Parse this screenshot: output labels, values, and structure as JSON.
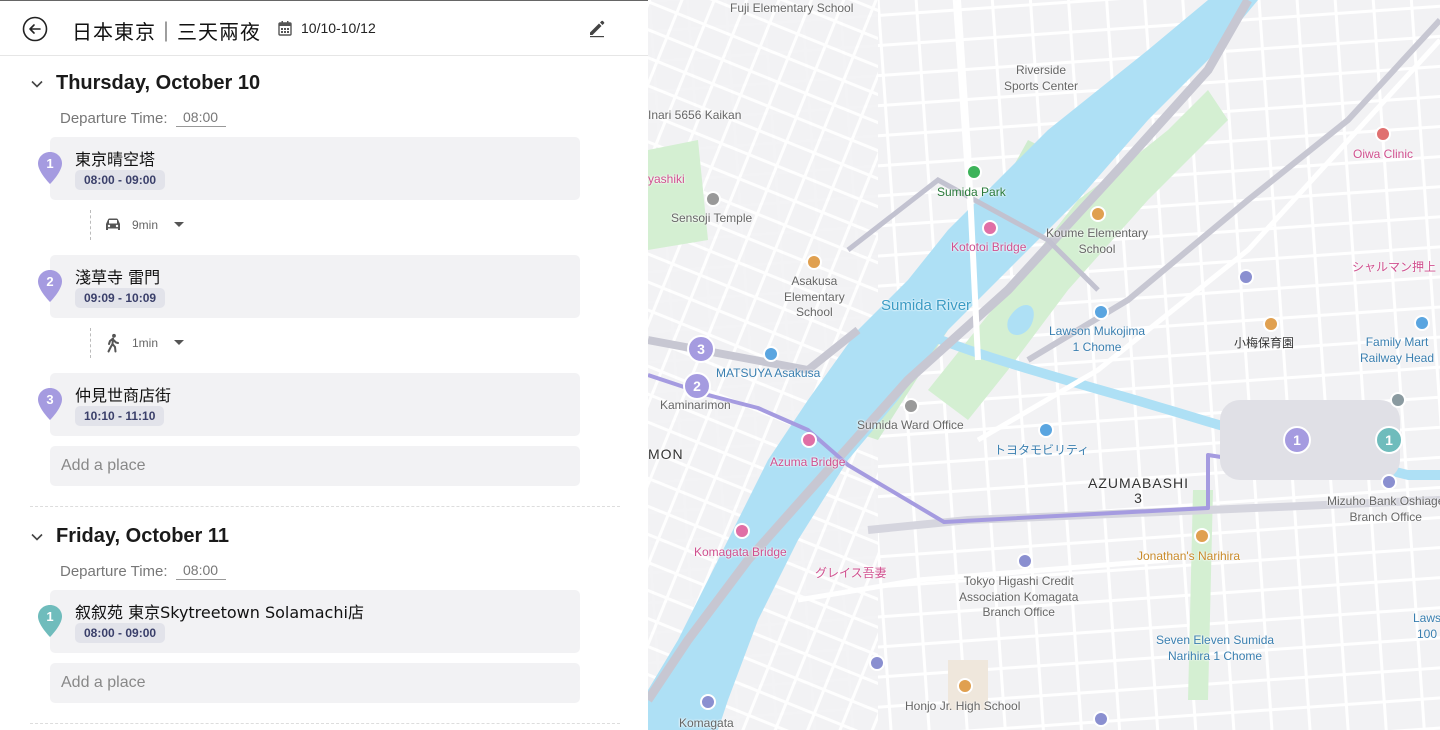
{
  "header": {
    "trip_title": "日本東京｜三天兩夜",
    "dates": "10/10-10/12"
  },
  "departure_label": "Departure Time:",
  "add_place_placeholder": "Add a place",
  "days": [
    {
      "title": "Thursday, October 10",
      "departure_time": "08:00",
      "stops": [
        {
          "num": "1",
          "name": "東京晴空塔",
          "time": "08:00 - 09:00",
          "pin_color": "#a59be0"
        },
        {
          "num": "2",
          "name": "淺草寺 雷門",
          "time": "09:09 - 10:09",
          "pin_color": "#a59be0"
        },
        {
          "num": "3",
          "name": "仲見世商店街",
          "time": "10:10 - 11:10",
          "pin_color": "#a59be0"
        }
      ],
      "transits": [
        {
          "mode": "car-icon",
          "duration": "9min"
        },
        {
          "mode": "walk-icon",
          "duration": "1min"
        }
      ]
    },
    {
      "title": "Friday, October 11",
      "departure_time": "08:00",
      "stops": [
        {
          "num": "1",
          "name": "叙叙苑 東京Skytreetown Solamachi店",
          "time": "08:00 - 09:00",
          "pin_color": "#6fbcbc"
        }
      ]
    }
  ],
  "map": {
    "labels": {
      "fuji": "Fuji Elementary School",
      "riverside": "Riverside\nSports Center",
      "inari": "Inari 5656 Kaikan",
      "oiwa": "Oiwa Clinic",
      "yashiki": "yashiki",
      "sensoji": "Sensoji Temple",
      "sumida_park": "Sumida Park",
      "kototoi": "Kototoi Bridge",
      "koume": "Koume Elementary\nSchool",
      "asakusa_school": "Asakusa\nElementary\nSchool",
      "sumida_river": "Sumida River",
      "sharuman": "シャルマン押上",
      "lawson": "Lawson Mukojima\n1 Chome",
      "koume_hoiku": "小梅保育園",
      "family_mart": "Family Mart\nRailway Head",
      "matsuya": "MATSUYA Asakusa",
      "kaminarimon": "Kaminarimon",
      "sumida_ward": "Sumida Ward Office",
      "toyota": "トヨタモビリティ",
      "mon": "MON",
      "azuma_bridge": "Azuma Bridge",
      "azumabashi": "AZUMABASHI\n3",
      "mizuho": "Mizuho Bank Oshiage\nBranch Office",
      "jonathans": "Jonathan's Narihira",
      "komagata_bridge": "Komagata Bridge",
      "grace": "グレイス吾妻",
      "tokyo_higashi": "Tokyo Higashi Credit\nAssociation Komagata\nBranch Office",
      "lawson100": "Laws\n100",
      "seven": "Seven Eleven Sumida\nNarihira 1 Chome",
      "honjo": "Honjo Jr. High School",
      "komagata": "Komagata"
    },
    "markers": [
      {
        "num": "3",
        "color": "#a59be0"
      },
      {
        "num": "2",
        "color": "#a59be0"
      },
      {
        "num": "1",
        "color": "#a59be0"
      },
      {
        "num": "1",
        "color": "#6fbcbc"
      }
    ]
  }
}
